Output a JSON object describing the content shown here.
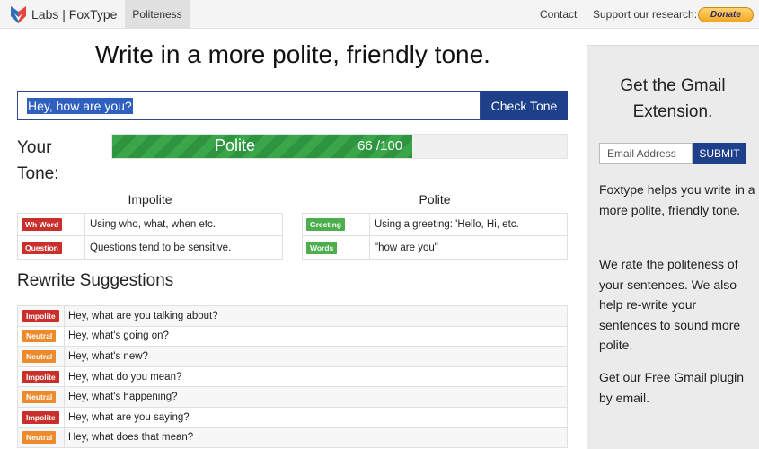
{
  "navbar": {
    "brand": "Labs | FoxType",
    "active_tab": "Politeness",
    "contact": "Contact",
    "support_label": "Support our research:",
    "donate_label": "Donate"
  },
  "headline": "Write in a more polite, friendly tone.",
  "input": {
    "value": "Hey, how are you?",
    "button_label": "Check Tone"
  },
  "tone": {
    "label": "Your Tone:",
    "result": "Polite",
    "score_text": "66 /100",
    "score_fraction": 0.66
  },
  "impolite": {
    "title": "Impolite",
    "rows": [
      {
        "tag": "Wh Word",
        "desc": "Using who, what, when etc."
      },
      {
        "tag": "Question",
        "desc": "Questions tend to be sensitive."
      }
    ]
  },
  "polite": {
    "title": "Polite",
    "rows": [
      {
        "tag": "Greeting",
        "desc": "Using a greeting: 'Hello, Hi, etc."
      },
      {
        "tag": "Words",
        "desc": "\"how are you\""
      }
    ]
  },
  "rewrite": {
    "title": "Rewrite Suggestions",
    "rows": [
      {
        "tag": "Impolite",
        "text": "Hey, what are you talking about?"
      },
      {
        "tag": "Neutral",
        "text": "Hey, what's going on?"
      },
      {
        "tag": "Neutral",
        "text": "Hey, what's new?"
      },
      {
        "tag": "Impolite",
        "text": "Hey, what do you mean?"
      },
      {
        "tag": "Neutral",
        "text": "Hey, what's happening?"
      },
      {
        "tag": "Impolite",
        "text": "Hey, what are you saying?"
      },
      {
        "tag": "Neutral",
        "text": "Hey, what does that mean?"
      }
    ]
  },
  "sidebar": {
    "title": "Get the Gmail Extension.",
    "email_placeholder": "Email Address",
    "submit_label": "SUBMIT",
    "para1": "Foxtype helps you write in a more polite, friendly tone.",
    "para2": "We rate the politeness of your sentences. We also help re-write your sentences to sound more polite.",
    "para3": "Get our Free Gmail plugin by email."
  },
  "colors": {
    "brand_blue": "#1e3f8a",
    "polite_green": "#3aa64a",
    "impolite_red": "#c9302c",
    "neutral_orange": "#ec8a2c"
  }
}
